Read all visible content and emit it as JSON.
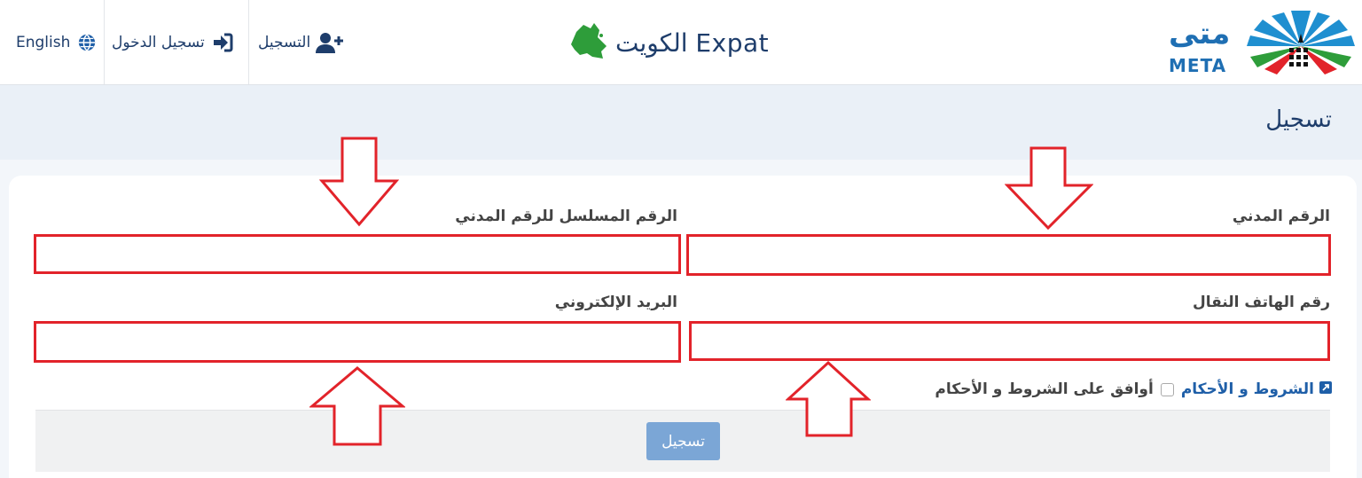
{
  "header": {
    "language": {
      "label": "English",
      "icon": "globe-icon"
    },
    "login": {
      "label": "تسجيل الدخول",
      "icon": "sign-in-icon"
    },
    "register": {
      "label": "التسجيل",
      "icon": "user-plus-icon"
    },
    "brand": {
      "text": "الكويت Expat",
      "icon": "kuwait-map-icon"
    },
    "logo": {
      "arabic": "متى",
      "latin": "META"
    }
  },
  "page": {
    "title": "تسجيل"
  },
  "form": {
    "civil_id": {
      "label": "الرقم المدني",
      "value": "",
      "placeholder": ""
    },
    "serial_no": {
      "label": "الرقم المسلسل للرقم المدني",
      "value": "",
      "placeholder": ""
    },
    "mobile": {
      "label": "رقم الهاتف النقال",
      "value": "",
      "placeholder": ""
    },
    "email": {
      "label": "البريد الإلكتروني",
      "value": "",
      "placeholder": ""
    },
    "terms_link": "الشروط و الأحكام",
    "agree_text": "أوافق على الشروط و الأحكام",
    "submit": "تسجيل"
  },
  "colors": {
    "primary": "#1e3d6b",
    "link": "#1f5fa8",
    "highlight": "#e2232a",
    "button": "#7ba6d6",
    "brand_green": "#2e9d3a"
  }
}
